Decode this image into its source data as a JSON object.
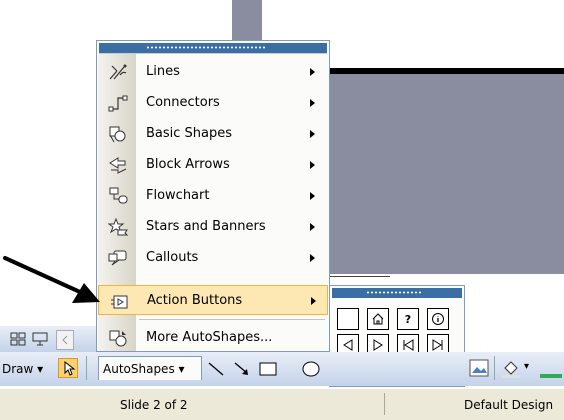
{
  "menu": {
    "items": [
      {
        "label": "Lines",
        "icon": "lines-icon",
        "has_submenu": true
      },
      {
        "label": "Connectors",
        "icon": "connectors-icon",
        "has_submenu": true
      },
      {
        "label": "Basic Shapes",
        "icon": "basic-shapes-icon",
        "has_submenu": true
      },
      {
        "label": "Block Arrows",
        "icon": "block-arrows-icon",
        "has_submenu": true
      },
      {
        "label": "Flowchart",
        "icon": "flowchart-icon",
        "has_submenu": true
      },
      {
        "label": "Stars and Banners",
        "icon": "stars-banners-icon",
        "has_submenu": true
      },
      {
        "label": "Callouts",
        "icon": "callouts-icon",
        "has_submenu": true
      },
      {
        "label": "Action Buttons",
        "icon": "action-buttons-icon",
        "has_submenu": true,
        "highlighted": true
      },
      {
        "label": "More AutoShapes...",
        "icon": "more-autoshapes-icon",
        "has_submenu": false
      }
    ]
  },
  "action_buttons": {
    "rows": [
      [
        "custom-action-icon",
        "home-action-icon",
        "help-action-icon",
        "information-action-icon"
      ],
      [
        "back-action-icon",
        "forward-action-icon",
        "beginning-action-icon",
        "end-action-icon"
      ],
      [
        "return-action-icon",
        "document-action-icon",
        "sound-action-icon",
        "movie-action-icon"
      ]
    ]
  },
  "toolbar": {
    "draw_label": "Draw ▾",
    "autoshapes_label": "AutoShapes ▾"
  },
  "status_bar": {
    "slide_label": "Slide 2 of 2",
    "design_label": "Default Design"
  },
  "colors": {
    "highlight": "#fde8b4",
    "menu_title": "#3a6ea5",
    "slide_bg": "#8a8da0"
  }
}
